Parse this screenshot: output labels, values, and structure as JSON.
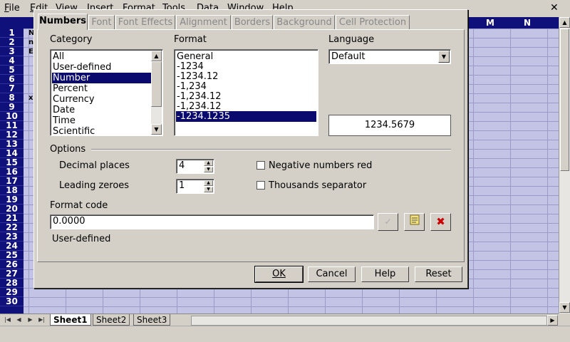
{
  "menubar": {
    "items": [
      "File",
      "Edit",
      "View",
      "Insert",
      "Format",
      "Tools",
      "Data",
      "Window",
      "Help"
    ],
    "close": "✕"
  },
  "sheet": {
    "column_headers": [
      "M",
      "N"
    ],
    "rows": [
      "1",
      "2",
      "3",
      "4",
      "5",
      "6",
      "7",
      "8",
      "9",
      "10",
      "11",
      "12",
      "13",
      "14",
      "15",
      "16",
      "17",
      "18",
      "19",
      "20",
      "21",
      "22",
      "23",
      "24",
      "25",
      "26",
      "27",
      "28",
      "29",
      "30"
    ],
    "cell_fragments": [
      "N",
      "n",
      "E",
      "x"
    ],
    "tabs": [
      "Sheet1",
      "Sheet2",
      "Sheet3"
    ],
    "active_tab": "Sheet1"
  },
  "dialog": {
    "tabs": [
      "Numbers",
      "Font",
      "Font Effects",
      "Alignment",
      "Borders",
      "Background",
      "Cell Protection"
    ],
    "active_tab": "Numbers",
    "category_label": "Category",
    "categories": [
      "All",
      "User-defined",
      "Number",
      "Percent",
      "Currency",
      "Date",
      "Time",
      "Scientific"
    ],
    "selected_category": "Number",
    "format_label": "Format",
    "formats": [
      "General",
      "-1234",
      "-1234.12",
      "-1,234",
      "-1,234.12",
      "-1,234.12",
      "-1234.1235"
    ],
    "selected_format": "-1234.1235",
    "language_label": "Language",
    "language_value": "Default",
    "preview_value": "1234.5679",
    "options_label": "Options",
    "decimal_places_label": "Decimal places",
    "decimal_places_value": "4",
    "leading_zeroes_label": "Leading zeroes",
    "leading_zeroes_value": "1",
    "negative_red_label": "Negative numbers red",
    "negative_red_checked": false,
    "thousands_sep_label": "Thousands separator",
    "thousands_sep_checked": false,
    "format_code_label": "Format code",
    "format_code_value": "0.0000",
    "format_description": "User-defined",
    "buttons": {
      "ok": "OK",
      "cancel": "Cancel",
      "help": "Help",
      "reset": "Reset"
    },
    "icon_buttons": [
      "checkmark-icon",
      "edit-comment-icon",
      "delete-icon"
    ]
  },
  "colors": {
    "header_bg": "#10107a",
    "selection": "#0a0a6e",
    "sheet_bg": "#c3c3e6",
    "delete_red": "#cc0000"
  }
}
